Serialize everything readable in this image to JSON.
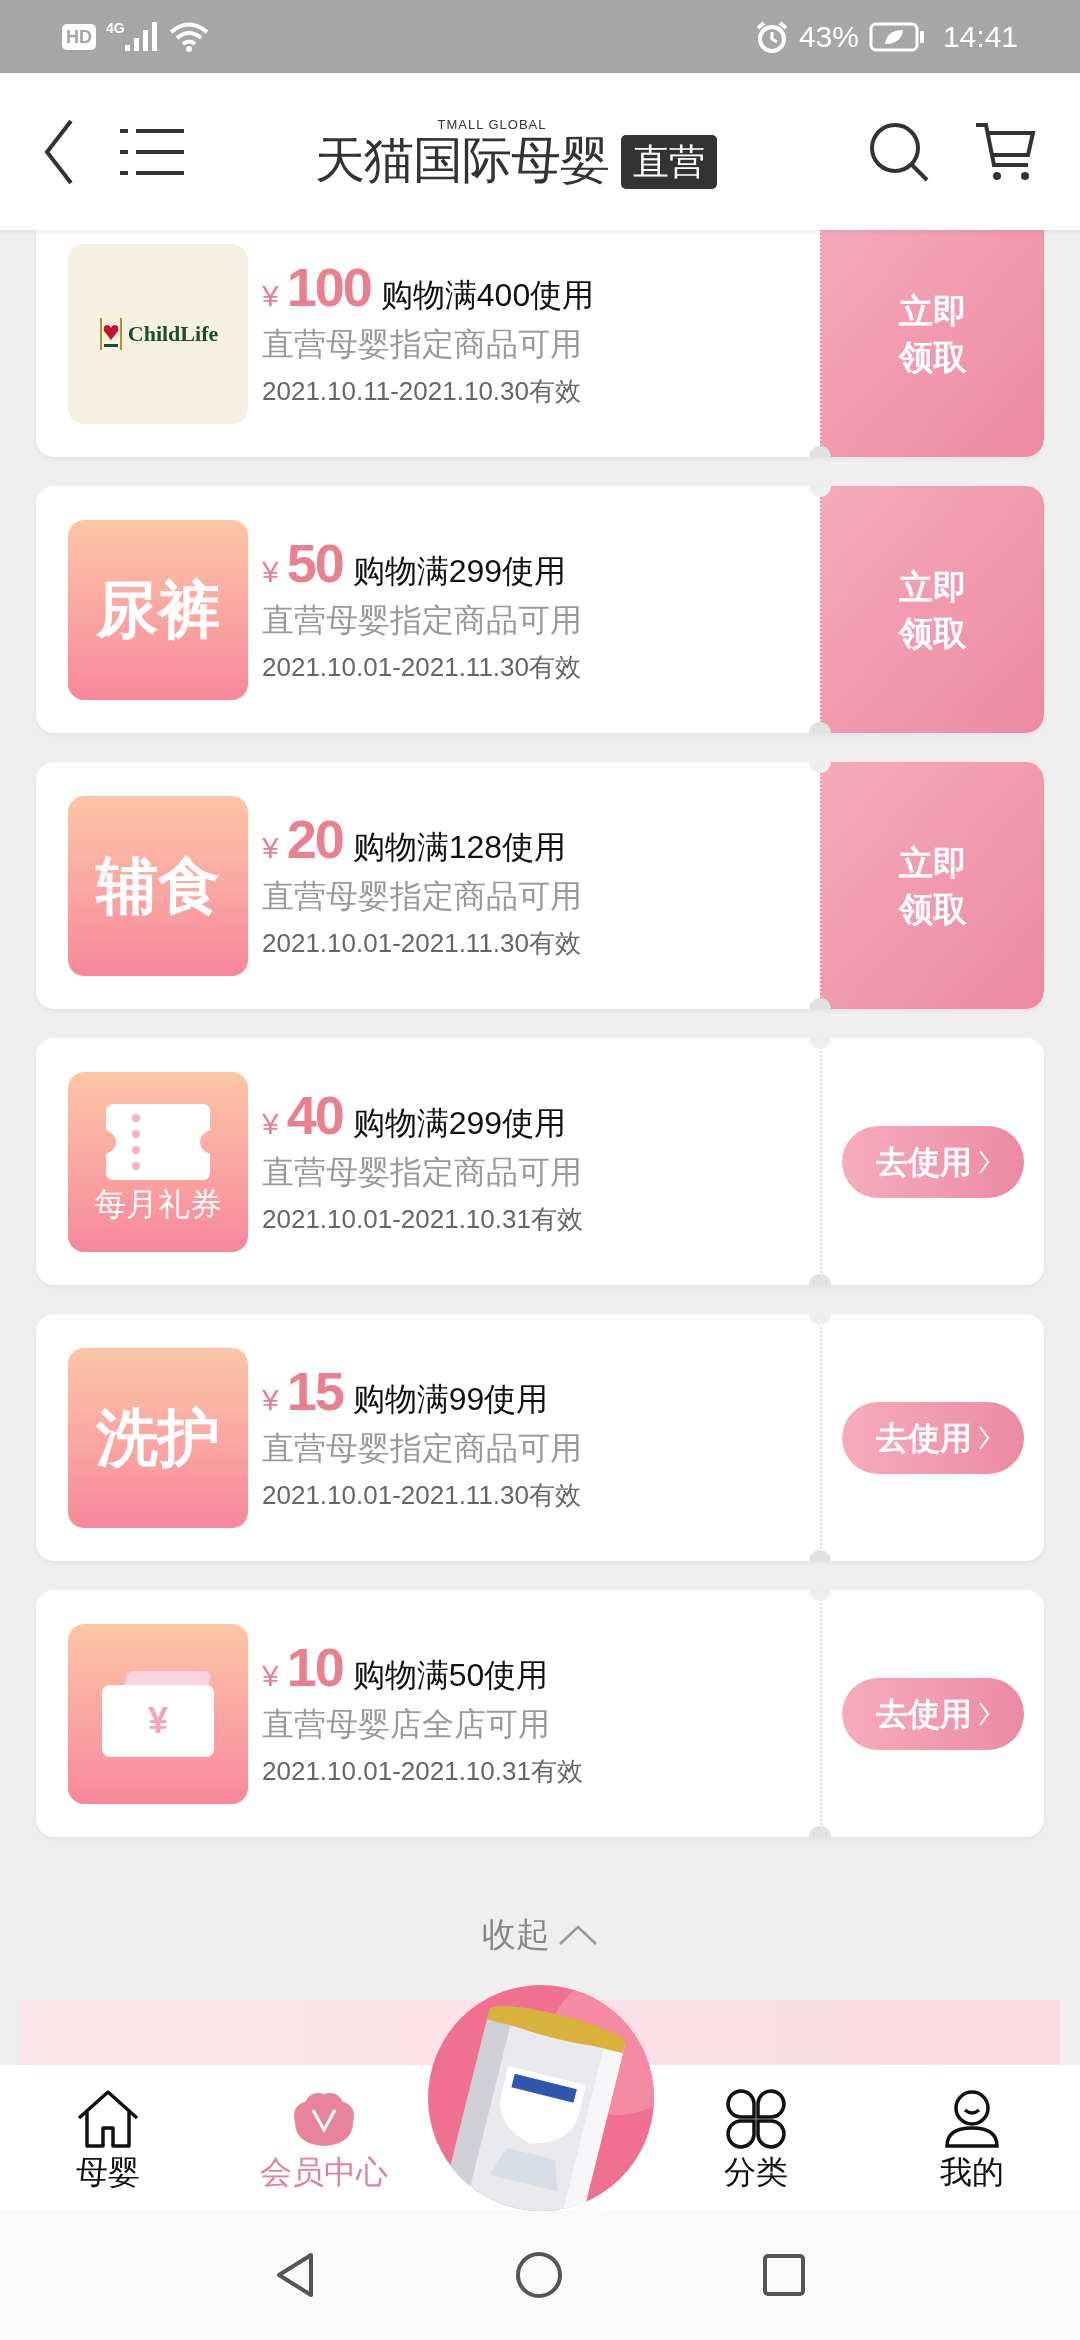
{
  "status_bar": {
    "hd": "HD",
    "network": "4G",
    "battery": "43%",
    "time": "14:41"
  },
  "header": {
    "brand_small": "TMALL GLOBAL",
    "brand": "天猫国际母婴",
    "badge": "直营"
  },
  "coupons": [
    {
      "icon": {
        "kind": "logo",
        "text": "ChildLife"
      },
      "currency": "¥",
      "amount": "100",
      "condition": "购物满400使用",
      "scope": "直营母婴指定商品可用",
      "validity": "2021.10.11-2021.10.30有效",
      "action": {
        "kind": "claim",
        "label": "立即领取"
      }
    },
    {
      "icon": {
        "kind": "text",
        "text": "尿裤"
      },
      "currency": "¥",
      "amount": "50",
      "condition": "购物满299使用",
      "scope": "直营母婴指定商品可用",
      "validity": "2021.10.01-2021.11.30有效",
      "action": {
        "kind": "claim",
        "label": "立即领取"
      }
    },
    {
      "icon": {
        "kind": "text",
        "text": "辅食"
      },
      "currency": "¥",
      "amount": "20",
      "condition": "购物满128使用",
      "scope": "直营母婴指定商品可用",
      "validity": "2021.10.01-2021.11.30有效",
      "action": {
        "kind": "claim",
        "label": "立即领取"
      }
    },
    {
      "icon": {
        "kind": "ticket",
        "text": "每月礼券"
      },
      "currency": "¥",
      "amount": "40",
      "condition": "购物满299使用",
      "scope": "直营母婴指定商品可用",
      "validity": "2021.10.01-2021.10.31有效",
      "action": {
        "kind": "use",
        "label": "去使用"
      }
    },
    {
      "icon": {
        "kind": "text",
        "text": "洗护"
      },
      "currency": "¥",
      "amount": "15",
      "condition": "购物满99使用",
      "scope": "直营母婴指定商品可用",
      "validity": "2021.10.01-2021.11.30有效",
      "action": {
        "kind": "use",
        "label": "去使用"
      }
    },
    {
      "icon": {
        "kind": "yen_ticket",
        "text": "¥"
      },
      "currency": "¥",
      "amount": "10",
      "condition": "购物满50使用",
      "scope": "直营母婴店全店可用",
      "validity": "2021.10.01-2021.10.31有效",
      "action": {
        "kind": "use",
        "label": "去使用"
      }
    }
  ],
  "collapse": {
    "label": "收起"
  },
  "tab_bar": [
    {
      "label": "母婴",
      "selected": false
    },
    {
      "label": "会员中心",
      "selected": true
    },
    {
      "label": "分类",
      "selected": false
    },
    {
      "label": "我的",
      "selected": false
    }
  ]
}
